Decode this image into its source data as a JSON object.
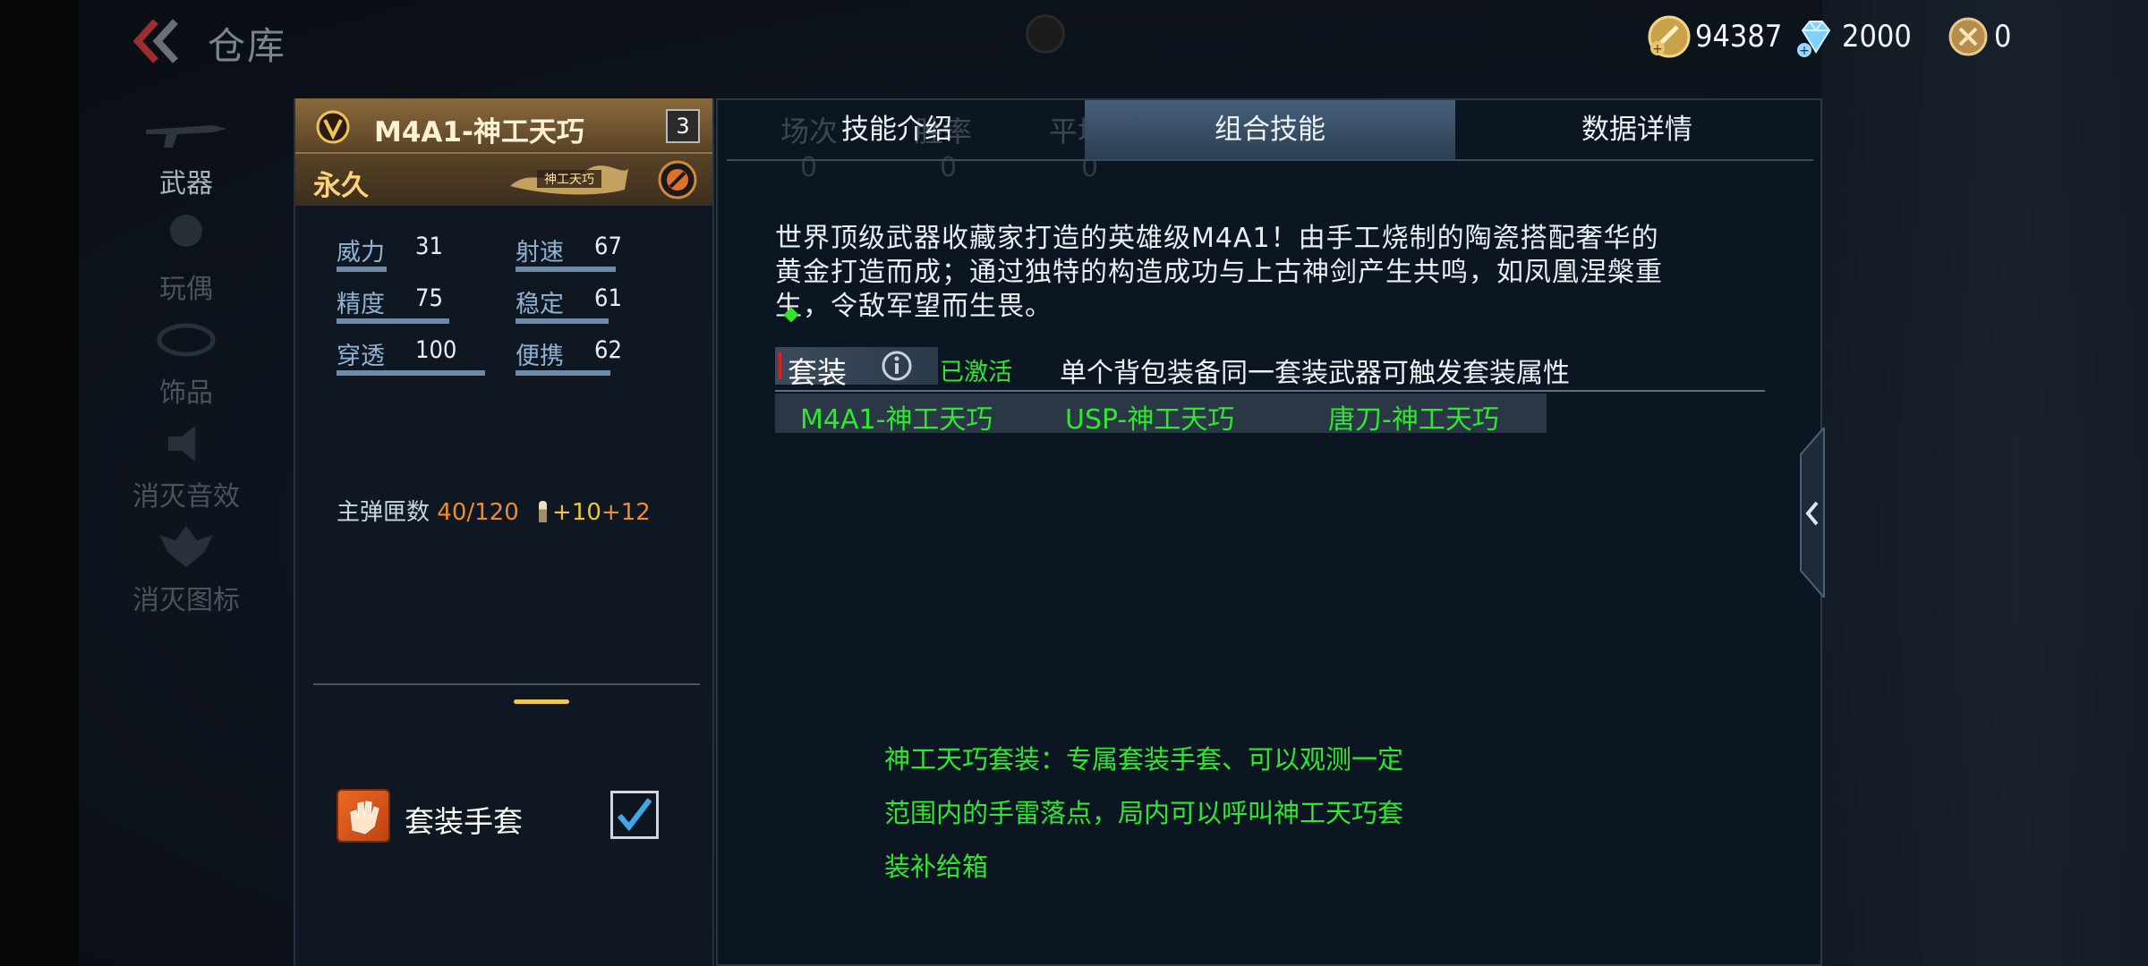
{
  "header": {
    "title": "仓库",
    "currencies": [
      {
        "icon": "gold-coin-icon",
        "value": "94387"
      },
      {
        "icon": "diamond-icon",
        "value": "2000"
      },
      {
        "icon": "honor-medal-icon",
        "value": "0"
      }
    ]
  },
  "categories": [
    {
      "label": "武器",
      "active": true
    },
    {
      "label": "玩偶",
      "active": false
    },
    {
      "label": "饰品",
      "active": false
    },
    {
      "label": "消灭音效",
      "active": false
    },
    {
      "label": "消灭图标",
      "active": false
    }
  ],
  "weapon": {
    "name": "M4A1-神工天巧",
    "level": "3",
    "duration": "永久",
    "emblem_text": "神工天巧",
    "stats": [
      {
        "label": "威力",
        "value": "31"
      },
      {
        "label": "射速",
        "value": "67"
      },
      {
        "label": "精度",
        "value": "75"
      },
      {
        "label": "稳定",
        "value": "61"
      },
      {
        "label": "穿透",
        "value": "100"
      },
      {
        "label": "便携",
        "value": "62"
      }
    ],
    "ammo": {
      "label": "主弹匣数",
      "current": "40",
      "sep": "/",
      "max": "120",
      "bonus1": "+10",
      "bonus2": "+12"
    },
    "gloves": {
      "label": "套装手套",
      "checked": true
    }
  },
  "detail": {
    "ghost_headers": [
      "场次",
      "胜率",
      "平均KDA"
    ],
    "ghost_values": [
      "0",
      "0",
      "0"
    ],
    "tabs": [
      {
        "label": "技能介绍",
        "active": false
      },
      {
        "label": "组合技能",
        "active": true
      },
      {
        "label": "数据详情",
        "active": false
      }
    ],
    "description_lines": [
      "世界顶级武器收藏家打造的英雄级M4A1！由手工烧制的陶瓷搭配奢华的",
      "黄金打造而成；通过独特的构造成功与上古神剑产生共鸣，如凤凰涅槃重",
      "生，令敌军望而生畏。"
    ],
    "suit": {
      "label": "套装",
      "status": "已激活",
      "hint": "单个背包装备同一套装武器可触发套装属性",
      "items": [
        "M4A1-神工天巧",
        "USP-神工天巧",
        "唐刀-神工天巧"
      ]
    },
    "bonus_lines": [
      "神工天巧套装：专属套装手套、可以观测一定",
      "范围内的手雷落点，局内可以呼叫神工天巧套",
      "装补给箱"
    ]
  },
  "colors": {
    "accent_gold": "#ffd27a",
    "active_green": "#2ee82e",
    "ammo_orange": "#f08a2a",
    "ammo_yellow": "#f2c534"
  }
}
